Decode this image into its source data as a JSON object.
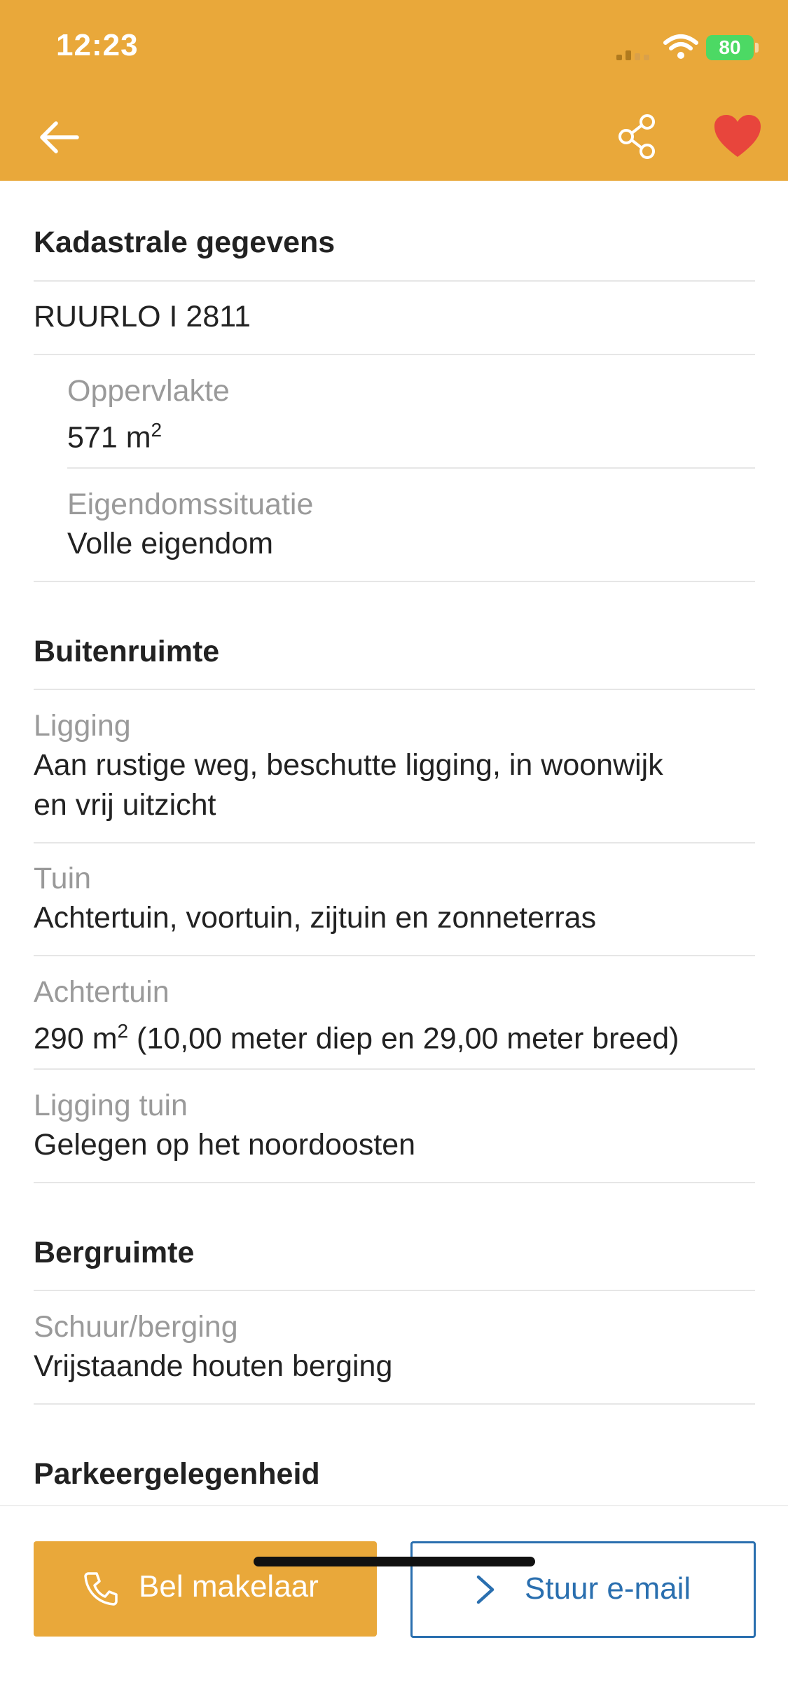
{
  "status_bar": {
    "time": "12:23",
    "battery": "80"
  },
  "nav": {
    "back_icon": "arrow-left-icon",
    "share_icon": "share-icon",
    "favorite_icon": "heart-icon",
    "accent_color": "#E9A83A",
    "favorite_color": "#E8453C"
  },
  "sections": {
    "kadastraal": {
      "title": "Kadastrale gegevens",
      "parcel": "RUURLO I 2811",
      "oppervlakte_label": "Oppervlakte",
      "oppervlakte_value": "571 m",
      "oppervlakte_sup": "2",
      "eigendom_label": "Eigendomssituatie",
      "eigendom_value": "Volle eigendom"
    },
    "buitenruimte": {
      "title": "Buitenruimte",
      "ligging_label": "Ligging",
      "ligging_value_line1": "Aan rustige weg, beschutte ligging, in woonwijk",
      "ligging_value_line2": "en vrij uitzicht",
      "tuin_label": "Tuin",
      "tuin_value": "Achtertuin, voortuin, zijtuin en zonneterras",
      "achtertuin_label": "Achtertuin",
      "achtertuin_value_pre": "290 m",
      "achtertuin_value_sup": "2",
      "achtertuin_value_post": " (10,00 meter diep en 29,00 meter breed)",
      "ligging_tuin_label": "Ligging tuin",
      "ligging_tuin_value": "Gelegen op het noordoosten"
    },
    "bergruimte": {
      "title": "Bergruimte",
      "schuur_label": "Schuur/berging",
      "schuur_value": "Vrijstaande houten berging"
    },
    "parkeer": {
      "title": "Parkeergelegenheid"
    }
  },
  "actions": {
    "call_label": "Bel makelaar",
    "call_icon": "phone-icon",
    "mail_label": "Stuur e-mail",
    "mail_icon": "chevron-right-icon",
    "mail_color": "#2A6FAF"
  }
}
